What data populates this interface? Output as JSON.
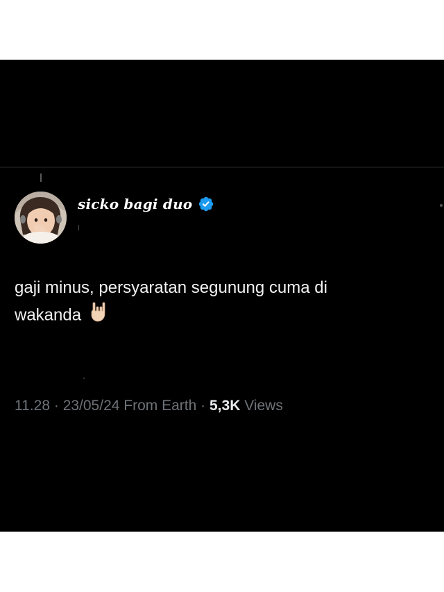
{
  "tweet": {
    "display_name": "sicko bagi duo",
    "text_line1": "gaji minus, persyaratan segunung cuma di",
    "text_line2": "wakanda",
    "emoji": "🤘",
    "time": "11.28",
    "date": "23/05/24",
    "source": "From Earth",
    "views_count": "5,3K",
    "views_label": "Views",
    "separator": "·"
  },
  "colors": {
    "background": "#000000",
    "text": "#f2f2f2",
    "meta": "#6e7378",
    "verified": "#1d9bf0"
  },
  "icons": {
    "verified": "verified-badge-icon",
    "avatar": "avatar-photo",
    "emoji": "rock-on-hand-icon"
  }
}
